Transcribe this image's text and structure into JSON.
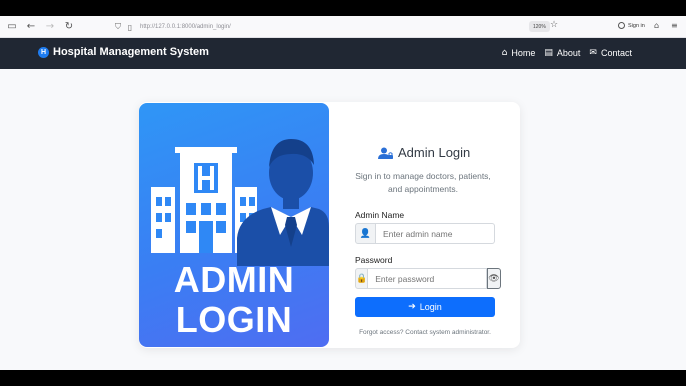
{
  "browser": {
    "url": "http://127.0.0.1:8000/admin_login/",
    "zoom": "120%",
    "sign_in": "Sign in"
  },
  "navbar": {
    "brand": "Hospital Management System",
    "brand_icon": "hospital-h-icon",
    "items": [
      {
        "label": "Home",
        "icon": "home-icon"
      },
      {
        "label": "About",
        "icon": "id-card-icon"
      },
      {
        "label": "Contact",
        "icon": "envelope-icon"
      }
    ]
  },
  "hero": {
    "line1": "ADMIN",
    "line2": "LOGIN"
  },
  "form": {
    "title": "Admin Login",
    "subtitle": "Sign in to manage doctors, patients, and appointments.",
    "admin_name_label": "Admin Name",
    "admin_name_placeholder": "Enter admin name",
    "password_label": "Password",
    "password_placeholder": "Enter password",
    "login_button": "Login",
    "forgot_text": "Forgot access? Contact system administrator."
  },
  "colors": {
    "navbar_bg": "#202733",
    "primary": "#0d6efd",
    "hero_gradient_start": "#2f96f6",
    "hero_gradient_end": "#4f6df2"
  }
}
